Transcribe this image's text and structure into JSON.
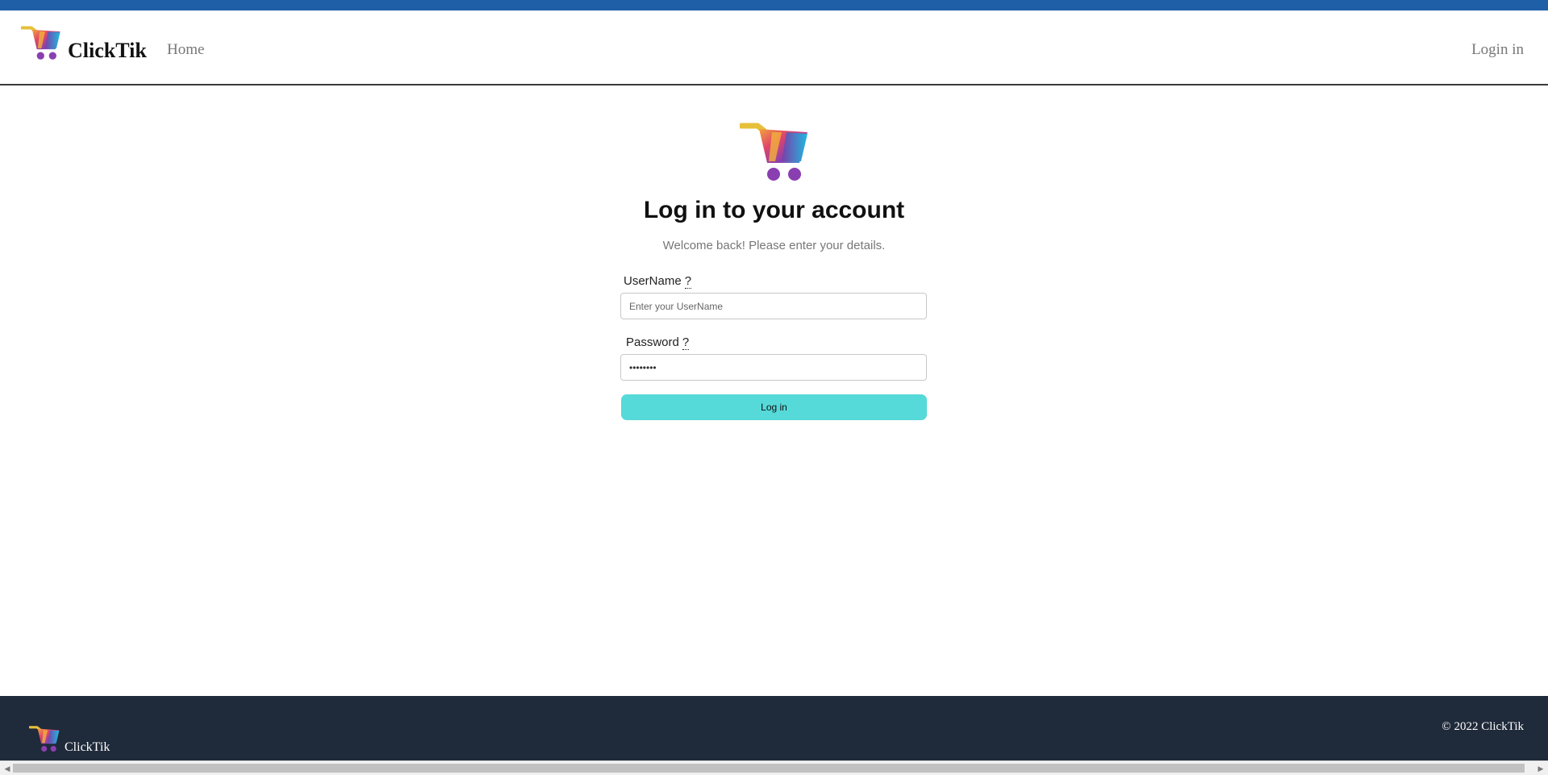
{
  "brand": {
    "name": "ClickTik"
  },
  "nav": {
    "home_label": "Home",
    "login_label": "Login in"
  },
  "login": {
    "title": "Log in to your account",
    "subtitle": "Welcome back! Please enter your details.",
    "username_label": "UserName",
    "username_help": "?",
    "username_placeholder": "Enter your UserName",
    "password_label": "Password",
    "password_help": "?",
    "password_value": "12345678",
    "submit_label": "Log in"
  },
  "footer": {
    "brand_name": "ClickTik",
    "copyright": "© 2022 ClickTik"
  },
  "colors": {
    "accent_button": "#56d9d9",
    "footer_bg": "#1f2a3a",
    "browser_bar": "#1f5fa8"
  },
  "icons": {
    "logo": "shopping-cart-logo-icon",
    "scroll_left": "arrow-left-icon",
    "scroll_right": "arrow-right-icon"
  },
  "scroll": {
    "left_glyph": "◀",
    "right_glyph": "▶"
  }
}
